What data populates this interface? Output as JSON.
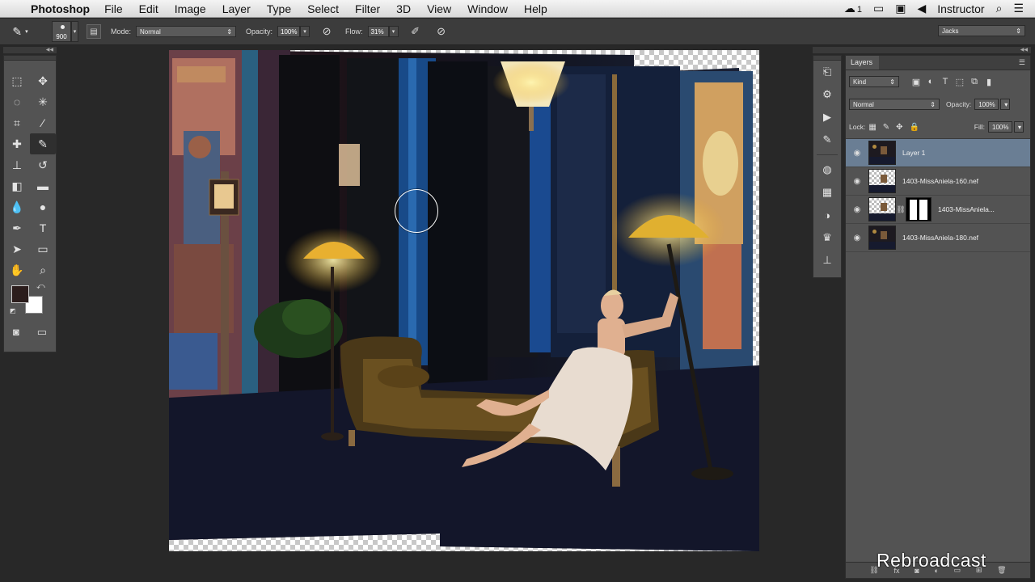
{
  "menubar": {
    "apple": "",
    "app_name": "Photoshop",
    "items": [
      "File",
      "Edit",
      "Image",
      "Layer",
      "Type",
      "Select",
      "Filter",
      "3D",
      "View",
      "Window",
      "Help"
    ],
    "status_count": "1",
    "user": "Instructor"
  },
  "options": {
    "brush_size": "900",
    "mode_label": "Mode:",
    "mode_value": "Normal",
    "opacity_label": "Opacity:",
    "opacity_value": "100%",
    "flow_label": "Flow:",
    "flow_value": "31%",
    "workspace": "Jacks"
  },
  "tools": {
    "foreground_color": "#2b1d1c",
    "background_color": "#ffffff"
  },
  "layers_panel": {
    "tab": "Layers",
    "filter_kind": "Kind",
    "blend_mode": "Normal",
    "opacity_label": "Opacity:",
    "opacity_value": "100%",
    "lock_label": "Lock:",
    "fill_label": "Fill:",
    "fill_value": "100%",
    "layers": [
      {
        "name": "Layer 1",
        "selected": true
      },
      {
        "name": "1403-MissAniela-160.nef",
        "selected": false
      },
      {
        "name": "1403-MissAniela...",
        "selected": false,
        "has_mask": true
      },
      {
        "name": "1403-MissAniela-180.nef",
        "selected": false
      }
    ]
  },
  "watermark": "Rebroadcast"
}
